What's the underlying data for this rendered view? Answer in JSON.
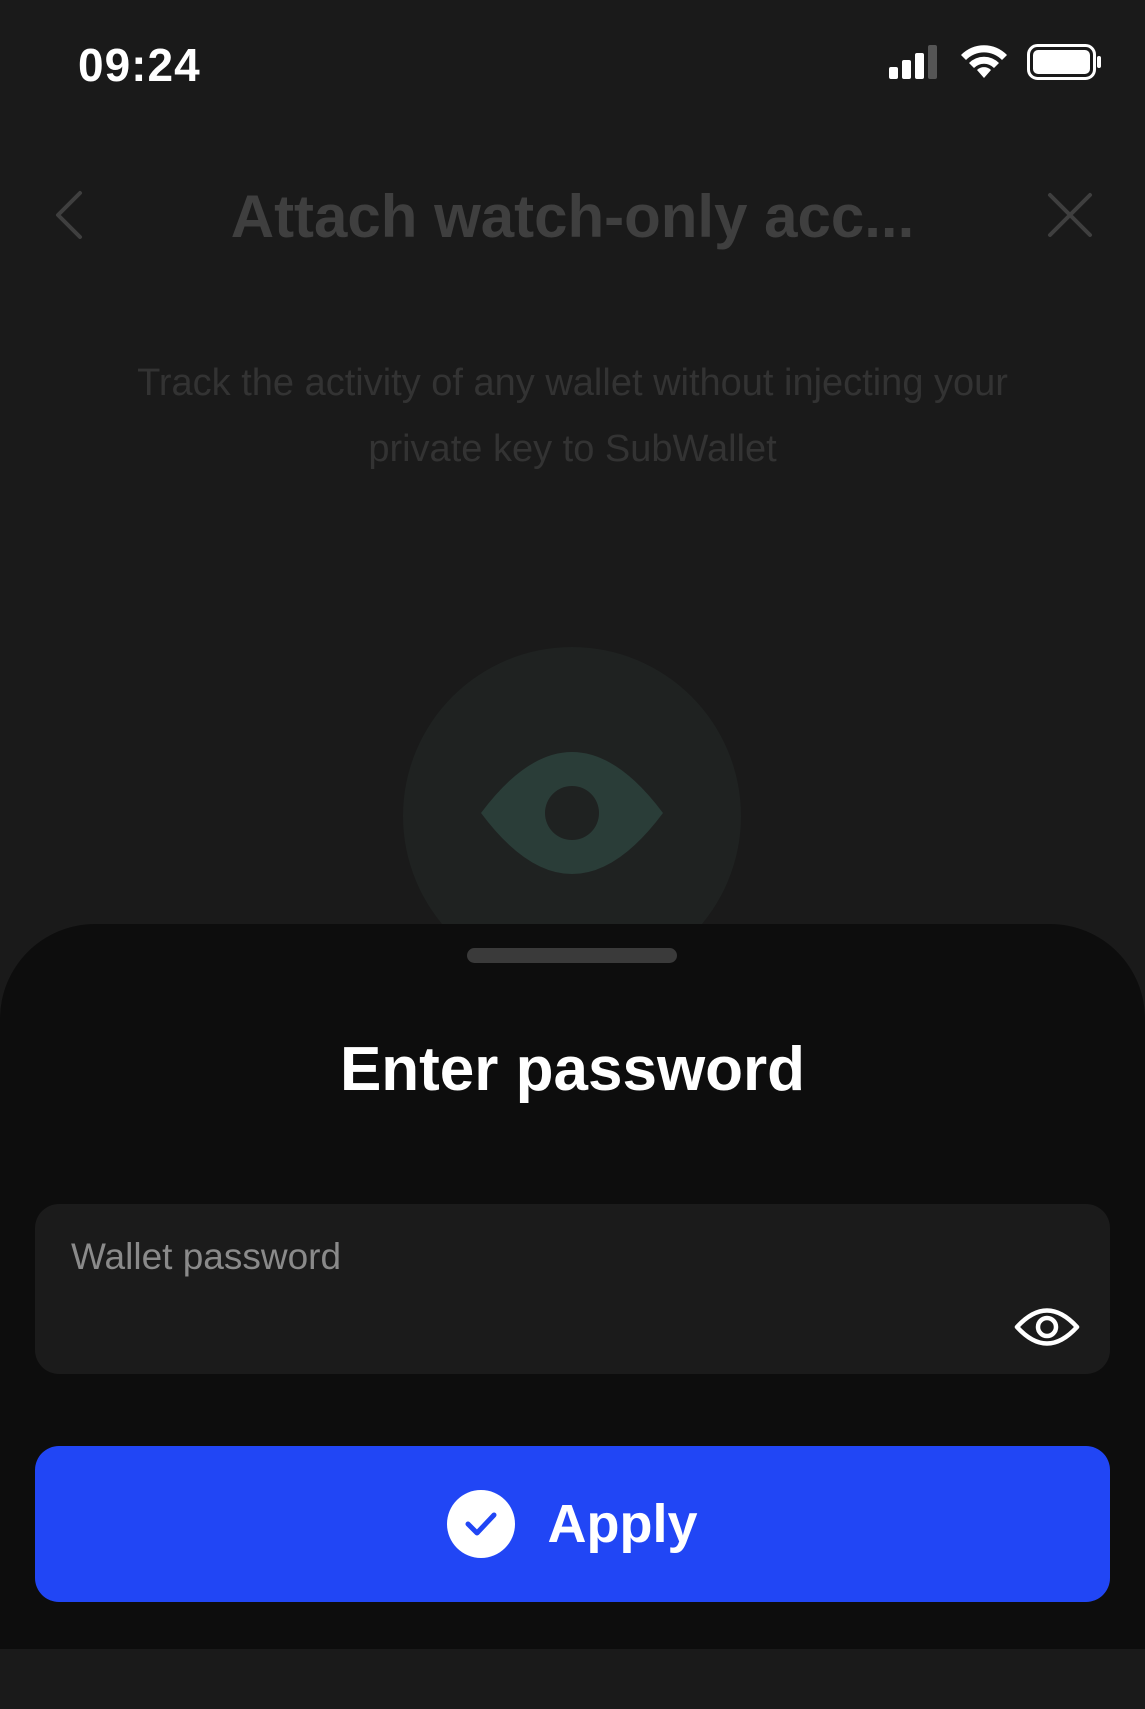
{
  "status_bar": {
    "time": "09:24",
    "icons": [
      "cellular-signal-icon",
      "wifi-icon",
      "battery-icon"
    ]
  },
  "header": {
    "title": "Attach watch-only acc...",
    "back_icon": "chevron-left-icon",
    "close_icon": "close-icon"
  },
  "description": "Track the activity of any wallet without injecting your private key to SubWallet",
  "hero_icon": "eye-icon",
  "sheet": {
    "title": "Enter password",
    "password_field": {
      "label": "Wallet password",
      "value": "",
      "toggle_icon": "eye-icon"
    },
    "apply_button": {
      "label": "Apply",
      "icon": "check-circle-icon"
    }
  },
  "colors": {
    "background": "#1a1a1a",
    "sheet": "#0d0d0d",
    "accent": "#2146f5",
    "hero_eye": "#2a3d38"
  }
}
